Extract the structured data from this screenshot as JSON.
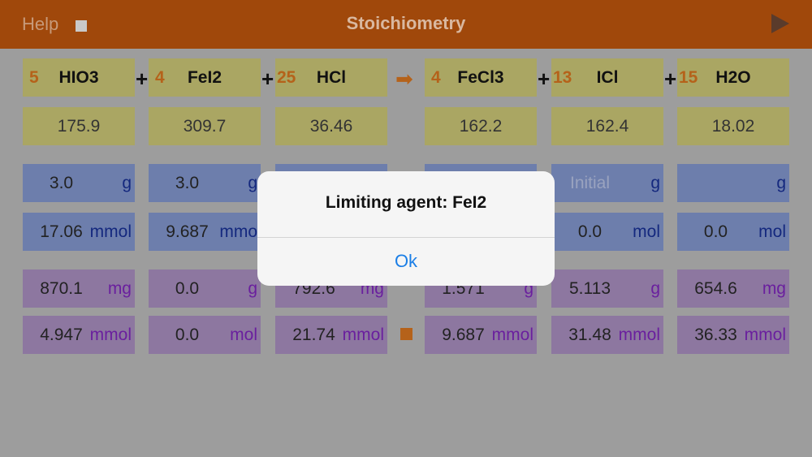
{
  "header": {
    "help_label": "Help",
    "title": "Stoichiometry",
    "icons": {
      "stop": "stop-square-icon",
      "play": "play-icon"
    }
  },
  "equation": {
    "plus": "+",
    "arrow": "arrow-right-icon",
    "compounds": [
      {
        "coef": "5",
        "name": "HIO3",
        "molar_mass": "175.9"
      },
      {
        "coef": "4",
        "name": "FeI2",
        "molar_mass": "309.7"
      },
      {
        "coef": "25",
        "name": "HCl",
        "molar_mass": "36.46"
      },
      {
        "coef": "4",
        "name": "FeCl3",
        "molar_mass": "162.2"
      },
      {
        "coef": "13",
        "name": "ICl",
        "molar_mass": "162.4"
      },
      {
        "coef": "15",
        "name": "H2O",
        "molar_mass": "18.02"
      }
    ]
  },
  "inputs": {
    "mass": [
      {
        "value": "3.0",
        "unit": "g"
      },
      {
        "value": "3.0",
        "unit": "g"
      },
      {
        "value": "",
        "unit": ""
      },
      {
        "value": "",
        "unit": ""
      },
      {
        "value": "",
        "placeholder": "Initial",
        "unit": "g"
      },
      {
        "value": "",
        "unit": "g"
      }
    ],
    "moles": [
      {
        "value": "17.06",
        "unit": "mmol"
      },
      {
        "value": "9.687",
        "unit": "mmo"
      },
      {
        "value": "",
        "unit": ""
      },
      {
        "value": "",
        "unit": ""
      },
      {
        "value": "0.0",
        "unit": "mol"
      },
      {
        "value": "0.0",
        "unit": "mol"
      }
    ]
  },
  "results": {
    "mass": [
      {
        "value": "870.1",
        "unit": "mg"
      },
      {
        "value": "0.0",
        "unit": "g"
      },
      {
        "value": "792.6",
        "unit": "mg"
      },
      {
        "value": "1.571",
        "unit": "g"
      },
      {
        "value": "5.113",
        "unit": "g"
      },
      {
        "value": "654.6",
        "unit": "mg"
      }
    ],
    "moles": [
      {
        "value": "4.947",
        "unit": "mmol"
      },
      {
        "value": "0.0",
        "unit": "mol"
      },
      {
        "value": "21.74",
        "unit": "mmol"
      },
      {
        "value": "9.687",
        "unit": "mmol"
      },
      {
        "value": "31.48",
        "unit": "mmol"
      },
      {
        "value": "36.33",
        "unit": "mmol"
      }
    ],
    "marker": "orange-square-icon"
  },
  "alert": {
    "message": "Limiting agent: FeI2",
    "button_label": "Ok"
  }
}
